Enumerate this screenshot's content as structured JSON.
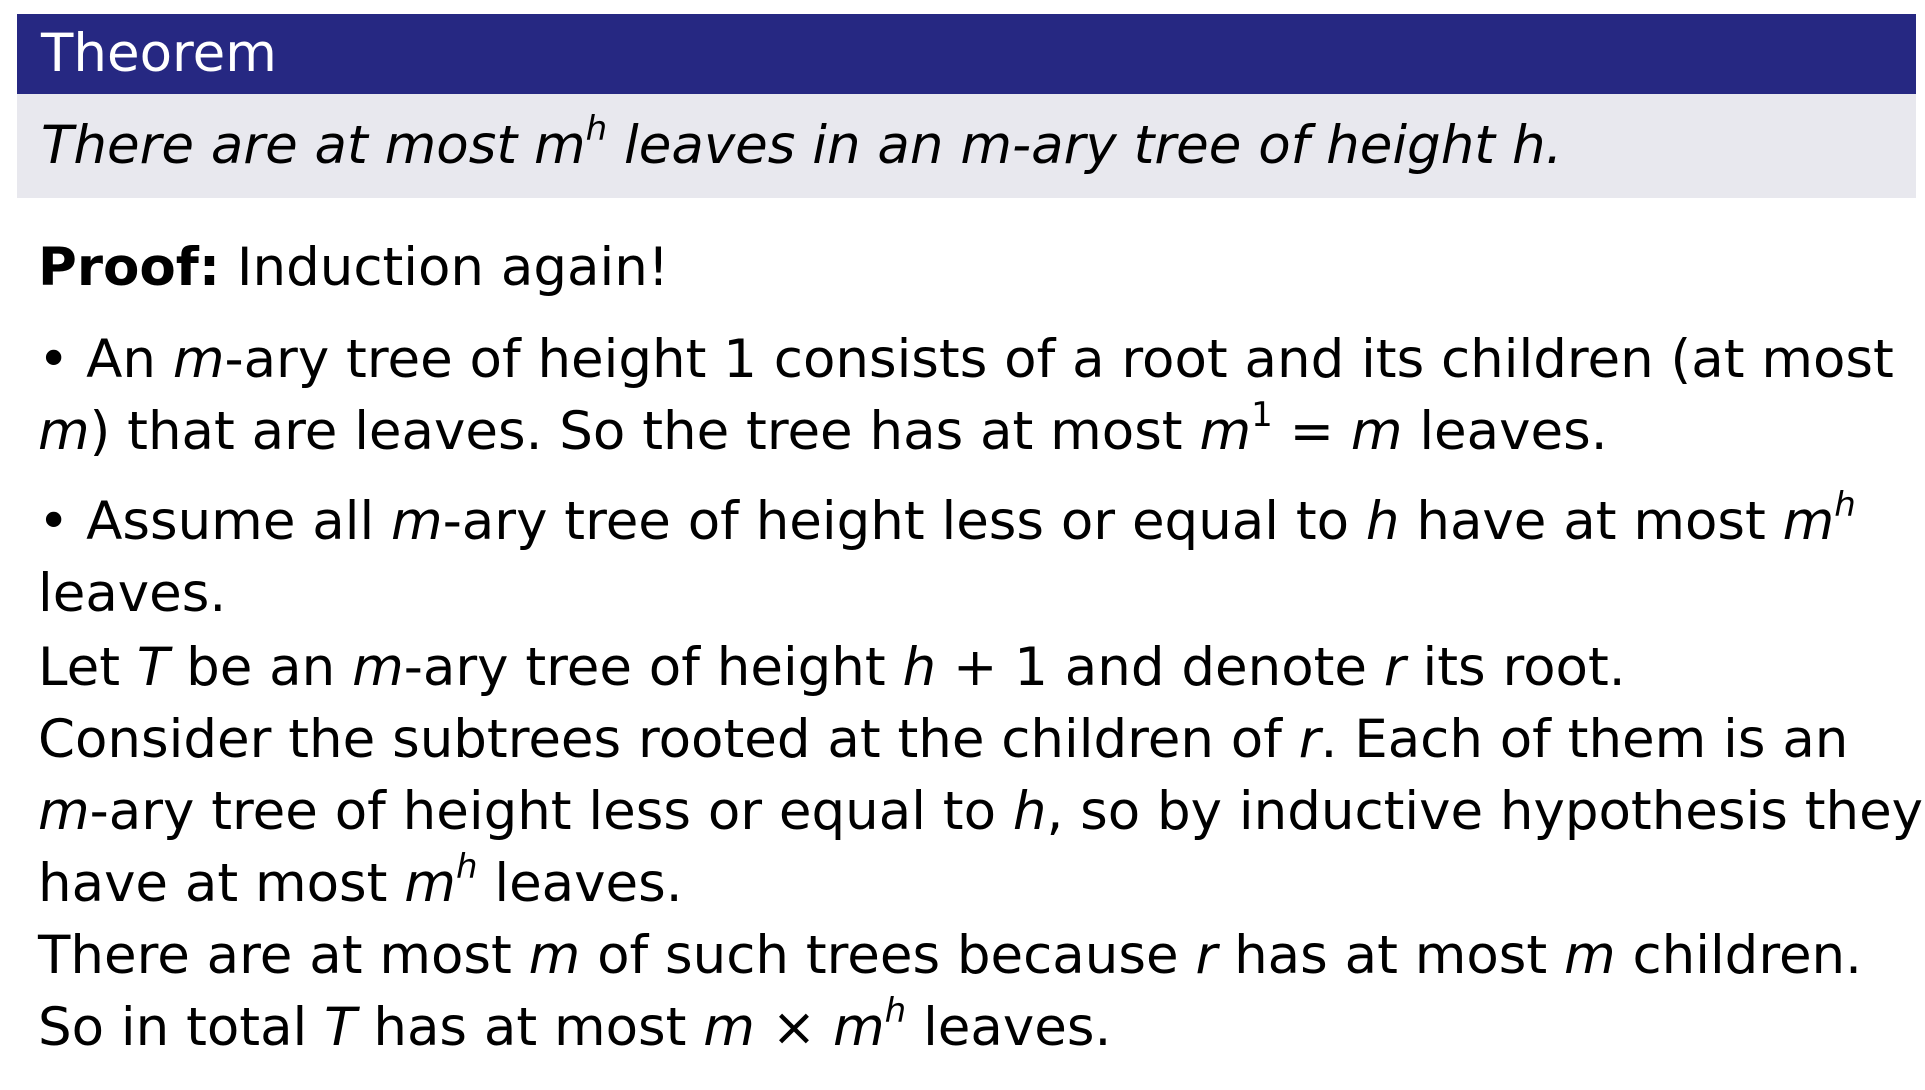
{
  "theorem": {
    "title": "Theorem",
    "statement": {
      "t1": "There are at most ",
      "m": "m",
      "h_sup": "h",
      "t2": " leaves in an ",
      "m2": "m",
      "t3": "-ary tree of height ",
      "h": "h",
      "t4": "."
    }
  },
  "proof": {
    "label": "Proof:",
    "intro": " Induction again!",
    "bullet1": {
      "bullet": "•",
      "t1": " An ",
      "m": "m",
      "t2": "-ary tree of height 1 consists of a root and its children (at most",
      "m2": "m",
      "t3": ") that are leaves. So the tree has at most ",
      "m3": "m",
      "sup1": "1",
      "eq": " = ",
      "m4": "m",
      "t4": " leaves."
    },
    "bullet2": {
      "bullet": "•",
      "t1": " Assume all ",
      "m": "m",
      "t2": "-ary tree of height less or equal to ",
      "h": "h",
      "t3": " have at most ",
      "m2": "m",
      "h_sup": "h",
      "t4": "leaves."
    },
    "let_line": {
      "t1": "Let ",
      "T": "T",
      "t2": " be an ",
      "m": "m",
      "t3": "-ary tree of height ",
      "h": "h",
      "plus": " + 1",
      "t4": " and denote ",
      "r": "r",
      "t5": " its root."
    },
    "consider": {
      "t1": "Consider the subtrees rooted at the children of ",
      "r": "r",
      "t2": ". Each of them is an",
      "m": "m",
      "t3": "-ary tree of height less or equal to ",
      "h": "h",
      "t4": ", so by inductive hypothesis they",
      "t5": "have at most ",
      "m2": "m",
      "h_sup": "h",
      "t6": " leaves."
    },
    "there_are": {
      "t1": "There are at most ",
      "m": "m",
      "t2": " of such trees because ",
      "r": "r",
      "t3": " has at most ",
      "m2": "m",
      "t4": " children."
    },
    "so_total": {
      "t1": "So in total ",
      "T": "T",
      "t2": " has at most ",
      "m": "m",
      "times": " × ",
      "m2": "m",
      "h_sup": "h",
      "t3": " leaves."
    }
  }
}
